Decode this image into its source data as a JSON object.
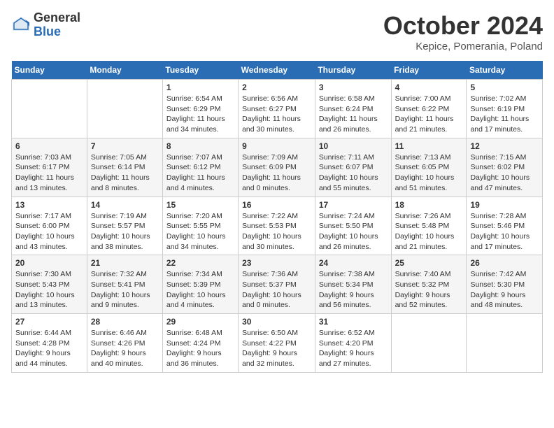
{
  "header": {
    "logo_general": "General",
    "logo_blue": "Blue",
    "title": "October 2024",
    "location": "Kepice, Pomerania, Poland"
  },
  "weekdays": [
    "Sunday",
    "Monday",
    "Tuesday",
    "Wednesday",
    "Thursday",
    "Friday",
    "Saturday"
  ],
  "weeks": [
    [
      {
        "day": "",
        "sunrise": "",
        "sunset": "",
        "daylight": ""
      },
      {
        "day": "",
        "sunrise": "",
        "sunset": "",
        "daylight": ""
      },
      {
        "day": "1",
        "sunrise": "Sunrise: 6:54 AM",
        "sunset": "Sunset: 6:29 PM",
        "daylight": "Daylight: 11 hours and 34 minutes."
      },
      {
        "day": "2",
        "sunrise": "Sunrise: 6:56 AM",
        "sunset": "Sunset: 6:27 PM",
        "daylight": "Daylight: 11 hours and 30 minutes."
      },
      {
        "day": "3",
        "sunrise": "Sunrise: 6:58 AM",
        "sunset": "Sunset: 6:24 PM",
        "daylight": "Daylight: 11 hours and 26 minutes."
      },
      {
        "day": "4",
        "sunrise": "Sunrise: 7:00 AM",
        "sunset": "Sunset: 6:22 PM",
        "daylight": "Daylight: 11 hours and 21 minutes."
      },
      {
        "day": "5",
        "sunrise": "Sunrise: 7:02 AM",
        "sunset": "Sunset: 6:19 PM",
        "daylight": "Daylight: 11 hours and 17 minutes."
      }
    ],
    [
      {
        "day": "6",
        "sunrise": "Sunrise: 7:03 AM",
        "sunset": "Sunset: 6:17 PM",
        "daylight": "Daylight: 11 hours and 13 minutes."
      },
      {
        "day": "7",
        "sunrise": "Sunrise: 7:05 AM",
        "sunset": "Sunset: 6:14 PM",
        "daylight": "Daylight: 11 hours and 8 minutes."
      },
      {
        "day": "8",
        "sunrise": "Sunrise: 7:07 AM",
        "sunset": "Sunset: 6:12 PM",
        "daylight": "Daylight: 11 hours and 4 minutes."
      },
      {
        "day": "9",
        "sunrise": "Sunrise: 7:09 AM",
        "sunset": "Sunset: 6:09 PM",
        "daylight": "Daylight: 11 hours and 0 minutes."
      },
      {
        "day": "10",
        "sunrise": "Sunrise: 7:11 AM",
        "sunset": "Sunset: 6:07 PM",
        "daylight": "Daylight: 10 hours and 55 minutes."
      },
      {
        "day": "11",
        "sunrise": "Sunrise: 7:13 AM",
        "sunset": "Sunset: 6:05 PM",
        "daylight": "Daylight: 10 hours and 51 minutes."
      },
      {
        "day": "12",
        "sunrise": "Sunrise: 7:15 AM",
        "sunset": "Sunset: 6:02 PM",
        "daylight": "Daylight: 10 hours and 47 minutes."
      }
    ],
    [
      {
        "day": "13",
        "sunrise": "Sunrise: 7:17 AM",
        "sunset": "Sunset: 6:00 PM",
        "daylight": "Daylight: 10 hours and 43 minutes."
      },
      {
        "day": "14",
        "sunrise": "Sunrise: 7:19 AM",
        "sunset": "Sunset: 5:57 PM",
        "daylight": "Daylight: 10 hours and 38 minutes."
      },
      {
        "day": "15",
        "sunrise": "Sunrise: 7:20 AM",
        "sunset": "Sunset: 5:55 PM",
        "daylight": "Daylight: 10 hours and 34 minutes."
      },
      {
        "day": "16",
        "sunrise": "Sunrise: 7:22 AM",
        "sunset": "Sunset: 5:53 PM",
        "daylight": "Daylight: 10 hours and 30 minutes."
      },
      {
        "day": "17",
        "sunrise": "Sunrise: 7:24 AM",
        "sunset": "Sunset: 5:50 PM",
        "daylight": "Daylight: 10 hours and 26 minutes."
      },
      {
        "day": "18",
        "sunrise": "Sunrise: 7:26 AM",
        "sunset": "Sunset: 5:48 PM",
        "daylight": "Daylight: 10 hours and 21 minutes."
      },
      {
        "day": "19",
        "sunrise": "Sunrise: 7:28 AM",
        "sunset": "Sunset: 5:46 PM",
        "daylight": "Daylight: 10 hours and 17 minutes."
      }
    ],
    [
      {
        "day": "20",
        "sunrise": "Sunrise: 7:30 AM",
        "sunset": "Sunset: 5:43 PM",
        "daylight": "Daylight: 10 hours and 13 minutes."
      },
      {
        "day": "21",
        "sunrise": "Sunrise: 7:32 AM",
        "sunset": "Sunset: 5:41 PM",
        "daylight": "Daylight: 10 hours and 9 minutes."
      },
      {
        "day": "22",
        "sunrise": "Sunrise: 7:34 AM",
        "sunset": "Sunset: 5:39 PM",
        "daylight": "Daylight: 10 hours and 4 minutes."
      },
      {
        "day": "23",
        "sunrise": "Sunrise: 7:36 AM",
        "sunset": "Sunset: 5:37 PM",
        "daylight": "Daylight: 10 hours and 0 minutes."
      },
      {
        "day": "24",
        "sunrise": "Sunrise: 7:38 AM",
        "sunset": "Sunset: 5:34 PM",
        "daylight": "Daylight: 9 hours and 56 minutes."
      },
      {
        "day": "25",
        "sunrise": "Sunrise: 7:40 AM",
        "sunset": "Sunset: 5:32 PM",
        "daylight": "Daylight: 9 hours and 52 minutes."
      },
      {
        "day": "26",
        "sunrise": "Sunrise: 7:42 AM",
        "sunset": "Sunset: 5:30 PM",
        "daylight": "Daylight: 9 hours and 48 minutes."
      }
    ],
    [
      {
        "day": "27",
        "sunrise": "Sunrise: 6:44 AM",
        "sunset": "Sunset: 4:28 PM",
        "daylight": "Daylight: 9 hours and 44 minutes."
      },
      {
        "day": "28",
        "sunrise": "Sunrise: 6:46 AM",
        "sunset": "Sunset: 4:26 PM",
        "daylight": "Daylight: 9 hours and 40 minutes."
      },
      {
        "day": "29",
        "sunrise": "Sunrise: 6:48 AM",
        "sunset": "Sunset: 4:24 PM",
        "daylight": "Daylight: 9 hours and 36 minutes."
      },
      {
        "day": "30",
        "sunrise": "Sunrise: 6:50 AM",
        "sunset": "Sunset: 4:22 PM",
        "daylight": "Daylight: 9 hours and 32 minutes."
      },
      {
        "day": "31",
        "sunrise": "Sunrise: 6:52 AM",
        "sunset": "Sunset: 4:20 PM",
        "daylight": "Daylight: 9 hours and 27 minutes."
      },
      {
        "day": "",
        "sunrise": "",
        "sunset": "",
        "daylight": ""
      },
      {
        "day": "",
        "sunrise": "",
        "sunset": "",
        "daylight": ""
      }
    ]
  ]
}
